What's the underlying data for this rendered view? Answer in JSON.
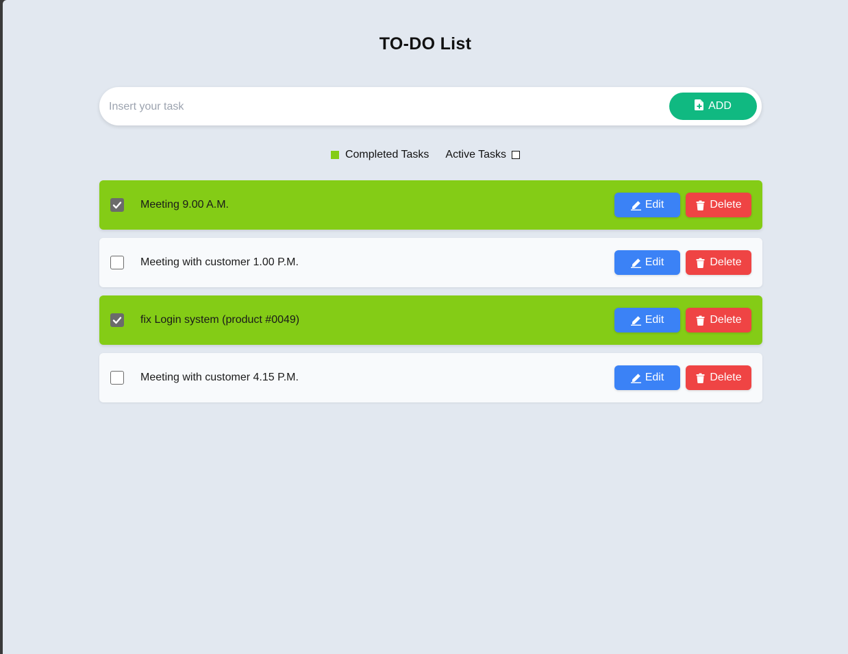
{
  "header": {
    "title": "TO-DO List"
  },
  "input": {
    "placeholder": "Insert your task",
    "value": "",
    "add_label": "ADD"
  },
  "legend": {
    "completed_label": "Completed Tasks",
    "active_label": "Active Tasks"
  },
  "tasks": [
    {
      "text": "Meeting 9.00 A.M.",
      "completed": true,
      "edit_label": "Edit",
      "delete_label": "Delete"
    },
    {
      "text": "Meeting with customer 1.00 P.M.",
      "completed": false,
      "edit_label": "Edit",
      "delete_label": "Delete"
    },
    {
      "text": "fix Login system (product #0049)",
      "completed": true,
      "edit_label": "Edit",
      "delete_label": "Delete"
    },
    {
      "text": "Meeting with customer 4.15 P.M.",
      "completed": false,
      "edit_label": "Edit",
      "delete_label": "Delete"
    }
  ],
  "colors": {
    "background": "#e2e8f0",
    "completed": "#84cc16",
    "active": "#f8fafc",
    "add_button": "#10b981",
    "edit_button": "#3b82f6",
    "delete_button": "#ef4444"
  },
  "icons": {
    "add": "file-plus-icon",
    "edit": "pen-icon",
    "delete": "trash-icon",
    "check": "check-icon"
  }
}
